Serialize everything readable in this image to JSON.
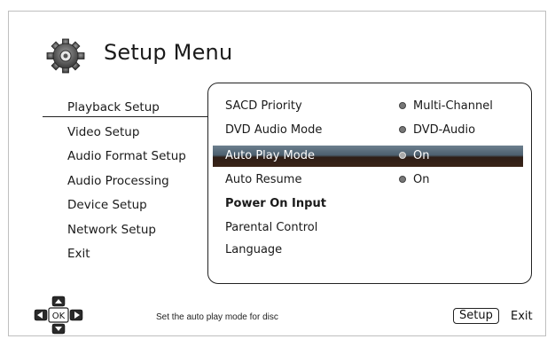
{
  "header": {
    "title": "Setup Menu",
    "icon": "gear-icon"
  },
  "left_menu": [
    {
      "label": "Playback Setup",
      "selected": true
    },
    {
      "label": "Video Setup"
    },
    {
      "label": "Audio Format Setup"
    },
    {
      "label": "Audio Processing"
    },
    {
      "label": "Device Setup"
    },
    {
      "label": "Network Setup"
    },
    {
      "label": "Exit"
    }
  ],
  "settings": [
    {
      "label": "SACD Priority",
      "value": "Multi-Channel"
    },
    {
      "label": "DVD Audio Mode",
      "value": "DVD-Audio"
    },
    {
      "label": "Auto Play Mode",
      "value": "On",
      "highlighted": true
    },
    {
      "label": "Auto Resume",
      "value": "On"
    },
    {
      "label": "Power On Input"
    },
    {
      "label": "Parental Control"
    },
    {
      "label": "Language"
    }
  ],
  "footer": {
    "hint": "Set the auto play mode for disc",
    "setup_label": "Setup",
    "exit_label": "Exit",
    "nav_center": "OK"
  },
  "colors": {
    "highlight_top": "#5d7080",
    "highlight_bottom": "#2e1e17"
  }
}
